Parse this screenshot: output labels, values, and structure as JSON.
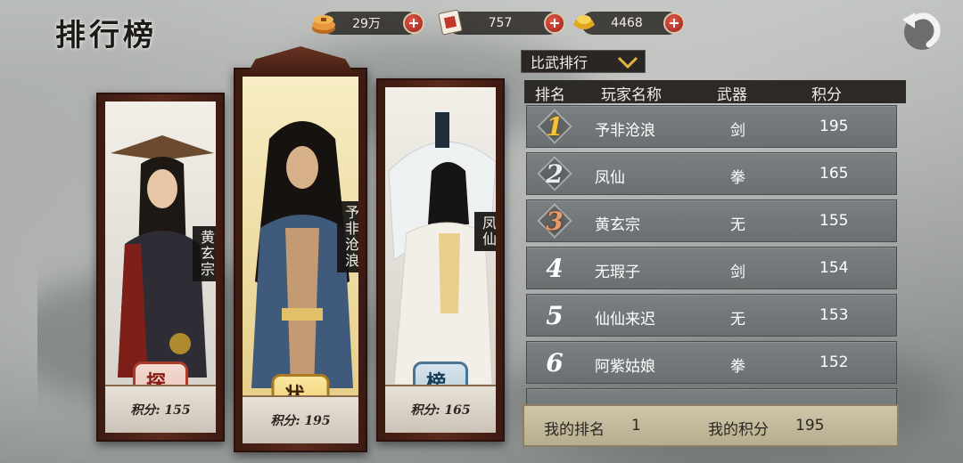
{
  "header": {
    "title": "排行榜"
  },
  "currencies": [
    {
      "name": "coins",
      "icon": "coin-stack-icon",
      "value": "29万"
    },
    {
      "name": "tokens",
      "icon": "ticket-icon",
      "value": "757"
    },
    {
      "name": "gold",
      "icon": "gold-ingot-icon",
      "value": "4468"
    }
  ],
  "ranking": {
    "dropdown_label": "比武排行",
    "columns": [
      "排名",
      "玩家名称",
      "武器",
      "积分"
    ],
    "rows": [
      {
        "rank": "1",
        "name": "予非沧浪",
        "weapon": "剑",
        "score": "195"
      },
      {
        "rank": "2",
        "name": "凤仙",
        "weapon": "拳",
        "score": "165"
      },
      {
        "rank": "3",
        "name": "黄玄宗",
        "weapon": "无",
        "score": "155"
      },
      {
        "rank": "4",
        "name": "无瑕子",
        "weapon": "剑",
        "score": "154"
      },
      {
        "rank": "5",
        "name": "仙仙来迟",
        "weapon": "无",
        "score": "153"
      },
      {
        "rank": "6",
        "name": "阿紫姑娘",
        "weapon": "拳",
        "score": "152"
      }
    ],
    "my_rank_label": "我的排名",
    "my_rank_value": "1",
    "my_score_label": "我的积分",
    "my_score_value": "195"
  },
  "podium": [
    {
      "place": "third",
      "name": "黄玄宗",
      "title": "探花",
      "score_text": "积分: 155"
    },
    {
      "place": "first",
      "name": "予非沧浪",
      "title": "状元",
      "score_text": "积分: 195"
    },
    {
      "place": "second",
      "name": "凤仙",
      "title": "榜眼",
      "score_text": "积分: 165"
    }
  ],
  "colors": {
    "frame": "#4a1f15",
    "gold": "#f4c23a",
    "row": "#72777a"
  }
}
